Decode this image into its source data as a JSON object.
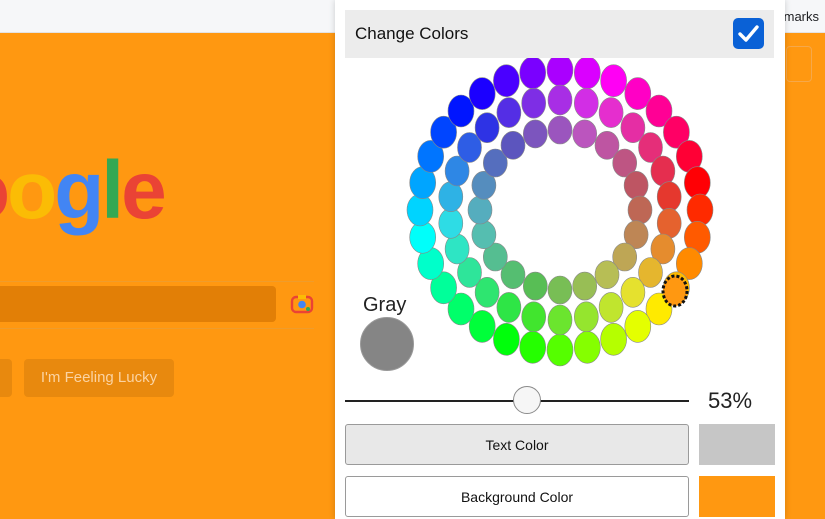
{
  "browser": {
    "bookmarks_label": "marks"
  },
  "google_page": {
    "logo_letters": [
      "o",
      "o",
      "g",
      "l",
      "e"
    ],
    "logo_colors": [
      "#ea4335",
      "#fbbc05",
      "#4285f4",
      "#34a853",
      "#ea4335"
    ],
    "lucky_button": "I'm Feeling Lucky"
  },
  "panel": {
    "title": "Change Colors",
    "enabled": true,
    "gray_label": "Gray",
    "gray_color": "#858585",
    "saturation_percent": 53,
    "saturation_label": "53%",
    "text_color_button": "Text Color",
    "text_color_value": "#c6c6c6",
    "background_color_button": "Background Color",
    "background_color_value": "#ff9811",
    "accent": "#0a61d6"
  },
  "wheel": {
    "selected": "orange"
  }
}
